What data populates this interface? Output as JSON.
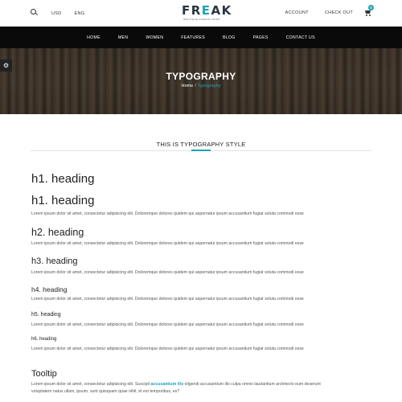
{
  "topbar": {
    "currency": "USD",
    "language": "ENG",
    "logo_text_f": "FR",
    "logo_text_e": "E",
    "logo_text_ak": "AK",
    "logo_sub": "BOUTIQUE FASHION SHOP",
    "account": "ACCOUNT",
    "checkout": "CHECK OUT",
    "cart_count": "0"
  },
  "nav": [
    "HOME",
    "MEN",
    "WOMEN",
    "FEATURES",
    "BLOG",
    "PAGES",
    "CONTACT US"
  ],
  "hero": {
    "title": "TYPOGRAPHY",
    "crumb_home": "Home",
    "crumb_sep": "/",
    "crumb_current": "Typography"
  },
  "section_title": "THIS IS TYPOGRAPHY STYLE",
  "headings": {
    "h1a": "h1. heading",
    "h1b": "h1. heading",
    "h2": "h2. heading",
    "h3": "h3. heading",
    "h4": "h4. heading",
    "h5": "h5. heading",
    "h6": "h6. heading",
    "tooltip": "Tooltip"
  },
  "lorem": "Lorem ipsum dolor sit amet, consectetur adipisicing elit. Doloremque dolores quidem qui aspernatur ipsum accusantium fugiat soluta commodi esse",
  "tooltip_text": {
    "before": "Lorem ipsum dolor sit amet, consectetur adipisicing elit. Suscipit ",
    "link": "accusantium illo",
    "after": " eligendi accusantium illo culpa omnis laudantium architecto eum deserunt",
    "line2": "voluptatem natus ullam, ipsum, sunt quisquam quae nihil, et est temporibus, ex?"
  },
  "colors": {
    "accent": "#1aa3b6",
    "nav_bg": "#0a0a0a"
  }
}
